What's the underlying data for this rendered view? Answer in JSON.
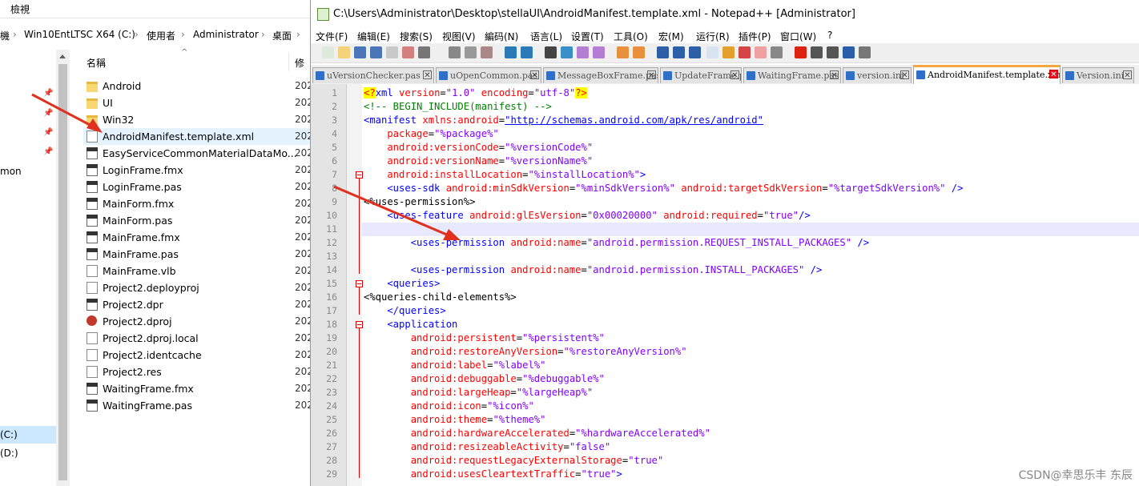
{
  "explorer": {
    "ribbon_tab": "檢視",
    "address": [
      "機",
      "Win10EntLTSC X64 (C:)",
      "使用者",
      "Administrator",
      "桌面"
    ],
    "address_sep": "›",
    "column_name": "名稱",
    "column_modified": "修",
    "nav_items": [
      {
        "label": "mon"
      },
      {
        "label": "(C:)"
      },
      {
        "label": "(D:)"
      }
    ],
    "files": [
      {
        "name": "Android",
        "type": "folder",
        "date": "202"
      },
      {
        "name": "UI",
        "type": "folder",
        "date": "202"
      },
      {
        "name": "Win32",
        "type": "folder",
        "date": "202"
      },
      {
        "name": "AndroidManifest.template.xml",
        "type": "doc",
        "date": "202"
      },
      {
        "name": "EasyServiceCommonMaterialDataMo...",
        "type": "pas",
        "date": "202"
      },
      {
        "name": "LoginFrame.fmx",
        "type": "fmx",
        "date": "202"
      },
      {
        "name": "LoginFrame.pas",
        "type": "pas",
        "date": "202"
      },
      {
        "name": "MainForm.fmx",
        "type": "fmx",
        "date": "202"
      },
      {
        "name": "MainForm.pas",
        "type": "pas",
        "date": "202"
      },
      {
        "name": "MainFrame.fmx",
        "type": "fmx",
        "date": "202"
      },
      {
        "name": "MainFrame.pas",
        "type": "pas",
        "date": "202"
      },
      {
        "name": "MainFrame.vlb",
        "type": "doc",
        "date": "202"
      },
      {
        "name": "Project2.deployproj",
        "type": "doc",
        "date": "202"
      },
      {
        "name": "Project2.dpr",
        "type": "pas",
        "date": "202"
      },
      {
        "name": "Project2.dproj",
        "type": "dproj",
        "date": "202"
      },
      {
        "name": "Project2.dproj.local",
        "type": "doc",
        "date": "202"
      },
      {
        "name": "Project2.identcache",
        "type": "doc",
        "date": "202"
      },
      {
        "name": "Project2.res",
        "type": "doc",
        "date": "202"
      },
      {
        "name": "WaitingFrame.fmx",
        "type": "fmx",
        "date": "202"
      },
      {
        "name": "WaitingFrame.pas",
        "type": "pas",
        "date": "202"
      }
    ]
  },
  "npp": {
    "title": "C:\\Users\\Administrator\\Desktop\\stellaUI\\AndroidManifest.template.xml - Notepad++ [Administrator]",
    "menu": [
      "文件(F)",
      "编辑(E)",
      "搜索(S)",
      "视图(V)",
      "編码(N)",
      "语言(L)",
      "设置(T)",
      "工具(O)",
      "宏(M)",
      "运行(R)",
      "插件(P)",
      "窗口(W)",
      "?"
    ],
    "tabs": [
      {
        "label": "uVersionChecker.pas",
        "active": false
      },
      {
        "label": "uOpenCommon.pas",
        "active": false
      },
      {
        "label": "MessageBoxFrame.pas",
        "active": false
      },
      {
        "label": "UpdateFrame.pas",
        "active": false
      },
      {
        "label": "WaitingFrame.pas",
        "active": false
      },
      {
        "label": "version.ini",
        "active": false
      },
      {
        "label": "AndroidManifest.template.xml",
        "active": true
      },
      {
        "label": "Version.ini",
        "active": false
      }
    ],
    "tab_close_glyph": "✕",
    "lines": [
      [
        {
          "t": "<?",
          "c": "pi"
        },
        {
          "t": "xml ",
          "c": "tag"
        },
        {
          "t": "version",
          "c": "attr"
        },
        {
          "t": "=",
          "c": "txt"
        },
        {
          "t": "\"1.0\"",
          "c": "val"
        },
        {
          "t": " encoding",
          "c": "attr"
        },
        {
          "t": "=",
          "c": "txt"
        },
        {
          "t": "\"utf-8\"",
          "c": "val"
        },
        {
          "t": "?>",
          "c": "pi"
        }
      ],
      [
        {
          "t": "<!-- BEGIN_INCLUDE(manifest) -->",
          "c": "cmt"
        }
      ],
      [
        {
          "t": "<manifest ",
          "c": "tag"
        },
        {
          "t": "xmlns:android",
          "c": "attr"
        },
        {
          "t": "=",
          "c": "txt"
        },
        {
          "t": "\"http://schemas.android.com/apk/res/android\"",
          "c": "lnk"
        }
      ],
      [
        {
          "t": "    package",
          "c": "attr"
        },
        {
          "t": "=",
          "c": "txt"
        },
        {
          "t": "\"%package%\"",
          "c": "val"
        }
      ],
      [
        {
          "t": "    android:versionCode",
          "c": "attr"
        },
        {
          "t": "=",
          "c": "txt"
        },
        {
          "t": "\"%versionCode%\"",
          "c": "val"
        }
      ],
      [
        {
          "t": "    android:versionName",
          "c": "attr"
        },
        {
          "t": "=",
          "c": "txt"
        },
        {
          "t": "\"%versionName%\"",
          "c": "val"
        }
      ],
      [
        {
          "t": "    android:installLocation",
          "c": "attr"
        },
        {
          "t": "=",
          "c": "txt"
        },
        {
          "t": "\"%installLocation%\"",
          "c": "val"
        },
        {
          "t": ">",
          "c": "tag"
        }
      ],
      [
        {
          "t": "    <uses-sdk ",
          "c": "tag"
        },
        {
          "t": "android:minSdkVersion",
          "c": "attr"
        },
        {
          "t": "=",
          "c": "txt"
        },
        {
          "t": "\"%minSdkVersion%\"",
          "c": "val"
        },
        {
          "t": " android:targetSdkVersion",
          "c": "attr"
        },
        {
          "t": "=",
          "c": "txt"
        },
        {
          "t": "\"%targetSdkVersion%\"",
          "c": "val"
        },
        {
          "t": " />",
          "c": "tag"
        }
      ],
      [
        {
          "t": "<%uses-permission%>",
          "c": "txt"
        }
      ],
      [
        {
          "t": "    <uses-feature ",
          "c": "tag"
        },
        {
          "t": "android:glEsVersion",
          "c": "attr"
        },
        {
          "t": "=",
          "c": "txt"
        },
        {
          "t": "\"0x00020000\"",
          "c": "val"
        },
        {
          "t": " android:required",
          "c": "attr"
        },
        {
          "t": "=",
          "c": "txt"
        },
        {
          "t": "\"true\"",
          "c": "val"
        },
        {
          "t": "/>",
          "c": "tag"
        }
      ],
      [
        {
          "t": "",
          "c": "txt"
        }
      ],
      [
        {
          "t": "        <uses-permission ",
          "c": "tag"
        },
        {
          "t": "android:name",
          "c": "attr"
        },
        {
          "t": "=",
          "c": "txt"
        },
        {
          "t": "\"android.permission.REQUEST_INSTALL_PACKAGES\"",
          "c": "val"
        },
        {
          "t": " />",
          "c": "tag"
        }
      ],
      [
        {
          "t": "",
          "c": "txt"
        }
      ],
      [
        {
          "t": "        <uses-permission ",
          "c": "tag"
        },
        {
          "t": "android:name",
          "c": "attr"
        },
        {
          "t": "=",
          "c": "txt"
        },
        {
          "t": "\"android.permission.INSTALL_PACKAGES\"",
          "c": "val"
        },
        {
          "t": " />",
          "c": "tag"
        }
      ],
      [
        {
          "t": "    <queries>",
          "c": "tag"
        }
      ],
      [
        {
          "t": "<%queries-child-elements%>",
          "c": "txt"
        }
      ],
      [
        {
          "t": "    </queries>",
          "c": "tag"
        }
      ],
      [
        {
          "t": "    <application",
          "c": "tag"
        }
      ],
      [
        {
          "t": "        android:persistent",
          "c": "attr"
        },
        {
          "t": "=",
          "c": "txt"
        },
        {
          "t": "\"%persistent%\"",
          "c": "val"
        }
      ],
      [
        {
          "t": "        android:restoreAnyVersion",
          "c": "attr"
        },
        {
          "t": "=",
          "c": "txt"
        },
        {
          "t": "\"%restoreAnyVersion%\"",
          "c": "val"
        }
      ],
      [
        {
          "t": "        android:label",
          "c": "attr"
        },
        {
          "t": "=",
          "c": "txt"
        },
        {
          "t": "\"%label%\"",
          "c": "val"
        }
      ],
      [
        {
          "t": "        android:debuggable",
          "c": "attr"
        },
        {
          "t": "=",
          "c": "txt"
        },
        {
          "t": "\"%debuggable%\"",
          "c": "val"
        }
      ],
      [
        {
          "t": "        android:largeHeap",
          "c": "attr"
        },
        {
          "t": "=",
          "c": "txt"
        },
        {
          "t": "\"%largeHeap%\"",
          "c": "val"
        }
      ],
      [
        {
          "t": "        android:icon",
          "c": "attr"
        },
        {
          "t": "=",
          "c": "txt"
        },
        {
          "t": "\"%icon%\"",
          "c": "val"
        }
      ],
      [
        {
          "t": "        android:theme",
          "c": "attr"
        },
        {
          "t": "=",
          "c": "txt"
        },
        {
          "t": "\"%theme%\"",
          "c": "val"
        }
      ],
      [
        {
          "t": "        android:hardwareAccelerated",
          "c": "attr"
        },
        {
          "t": "=",
          "c": "txt"
        },
        {
          "t": "\"%hardwareAccelerated%\"",
          "c": "val"
        }
      ],
      [
        {
          "t": "        android:resizeableActivity",
          "c": "attr"
        },
        {
          "t": "=",
          "c": "txt"
        },
        {
          "t": "\"false\"",
          "c": "val"
        }
      ],
      [
        {
          "t": "        android:requestLegacyExternalStorage",
          "c": "attr"
        },
        {
          "t": "=",
          "c": "txt"
        },
        {
          "t": "\"true\"",
          "c": "val"
        }
      ],
      [
        {
          "t": "        android:usesCleartextTraffic",
          "c": "attr"
        },
        {
          "t": "=",
          "c": "txt"
        },
        {
          "t": "\"true\"",
          "c": "val"
        },
        {
          "t": ">",
          "c": "tag"
        }
      ]
    ],
    "current_line": 11
  },
  "watermark": "CSDN@幸思乐丰 东辰",
  "colors": {
    "arrow": "#e0301e",
    "accent": "#f4a640",
    "selection": "#cce8ff"
  }
}
